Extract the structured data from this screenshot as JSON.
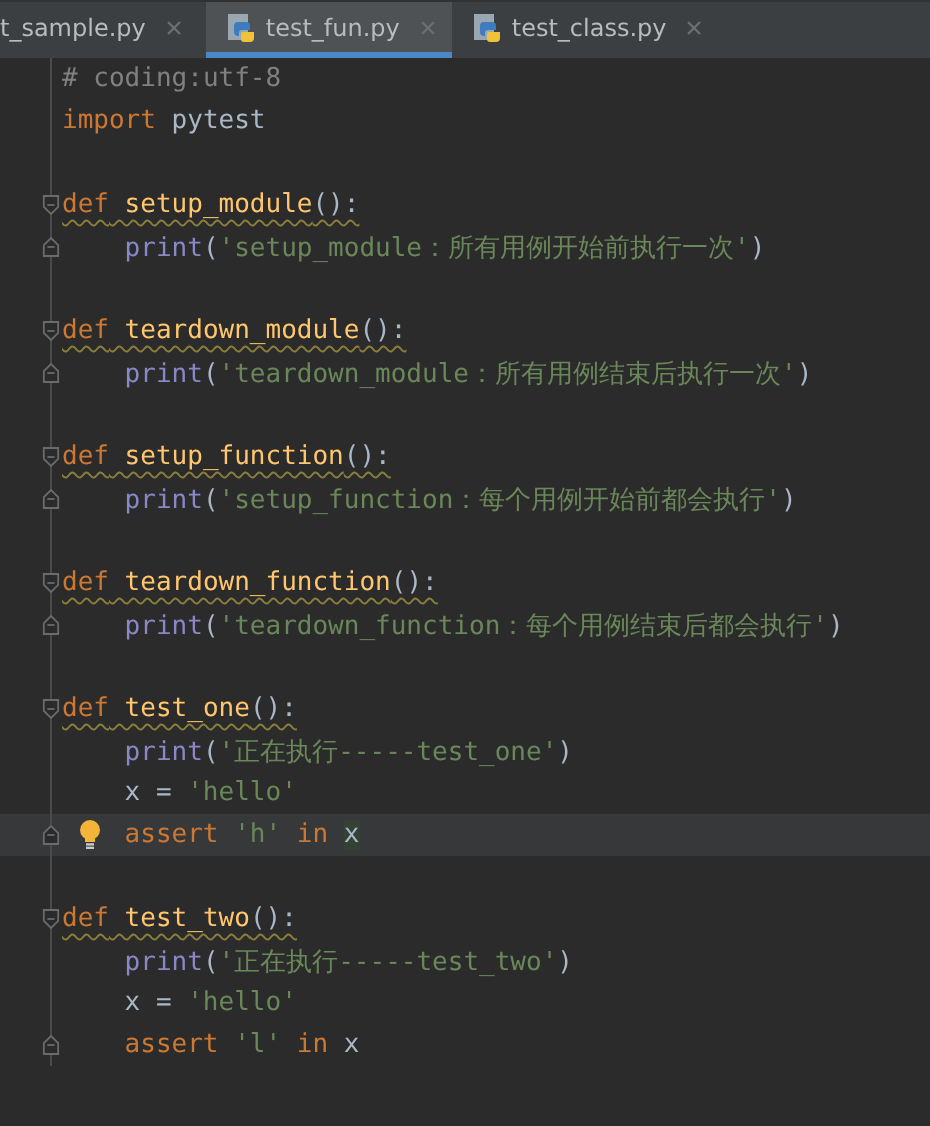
{
  "tabs": [
    {
      "label": "t_sample.py",
      "selected": false,
      "icon": false
    },
    {
      "label": "test_fun.py",
      "selected": true,
      "icon": true
    },
    {
      "label": "test_class.py",
      "selected": false,
      "icon": true
    }
  ],
  "lines": [
    {
      "kind": "code",
      "current": false,
      "warning": false,
      "tokens": [
        {
          "kind": "comment",
          "text": "# coding:utf-8"
        }
      ]
    },
    {
      "kind": "code",
      "current": false,
      "warning": false,
      "tokens": [
        {
          "kind": "keyword",
          "text": "import"
        },
        {
          "kind": "plain",
          "text": " pytest"
        }
      ]
    },
    {
      "kind": "blank",
      "current": false
    },
    {
      "kind": "code",
      "current": false,
      "warning": true,
      "fold_open": true,
      "tokens": [
        {
          "kind": "keyword",
          "text": "def"
        },
        {
          "kind": "func",
          "text": " setup_module"
        },
        {
          "kind": "plain",
          "text": "():"
        }
      ],
      "children": [
        {
          "kind": "code",
          "current": false,
          "warning": false,
          "fold_close": true,
          "tokens": [
            {
              "kind": "builtin",
              "text": "print"
            },
            {
              "kind": "plain",
              "text": "("
            },
            {
              "kind": "string",
              "text": "'setup_module：所有用例开始前执行一次'"
            },
            {
              "kind": "plain",
              "text": ")"
            }
          ]
        }
      ]
    },
    {
      "kind": "blank",
      "current": false
    },
    {
      "kind": "code",
      "current": false,
      "warning": true,
      "fold_open": true,
      "tokens": [
        {
          "kind": "keyword",
          "text": "def"
        },
        {
          "kind": "func",
          "text": " teardown_module"
        },
        {
          "kind": "plain",
          "text": "():"
        }
      ],
      "children": [
        {
          "kind": "code",
          "current": false,
          "warning": false,
          "fold_close": true,
          "tokens": [
            {
              "kind": "builtin",
              "text": "print"
            },
            {
              "kind": "plain",
              "text": "("
            },
            {
              "kind": "string",
              "text": "'teardown_module：所有用例结束后执行一次'"
            },
            {
              "kind": "plain",
              "text": ")"
            }
          ]
        }
      ]
    },
    {
      "kind": "blank",
      "current": false
    },
    {
      "kind": "code",
      "current": false,
      "warning": true,
      "fold_open": true,
      "tokens": [
        {
          "kind": "keyword",
          "text": "def"
        },
        {
          "kind": "func",
          "text": " setup_function"
        },
        {
          "kind": "plain",
          "text": "():"
        }
      ],
      "children": [
        {
          "kind": "code",
          "current": false,
          "warning": false,
          "fold_close": true,
          "tokens": [
            {
              "kind": "builtin",
              "text": "print"
            },
            {
              "kind": "plain",
              "text": "("
            },
            {
              "kind": "string",
              "text": "'setup_function：每个用例开始前都会执行'"
            },
            {
              "kind": "plain",
              "text": ")"
            }
          ]
        }
      ]
    },
    {
      "kind": "blank",
      "current": false
    },
    {
      "kind": "code",
      "current": false,
      "warning": true,
      "fold_open": true,
      "tokens": [
        {
          "kind": "keyword",
          "text": "def"
        },
        {
          "kind": "func",
          "text": " teardown_function"
        },
        {
          "kind": "plain",
          "text": "():"
        }
      ],
      "children": [
        {
          "kind": "code",
          "current": false,
          "warning": false,
          "fold_close": true,
          "tokens": [
            {
              "kind": "builtin",
              "text": "print"
            },
            {
              "kind": "plain",
              "text": "("
            },
            {
              "kind": "string",
              "text": "'teardown_function：每个用例结束后都会执行'"
            },
            {
              "kind": "plain",
              "text": ")"
            }
          ]
        }
      ]
    },
    {
      "kind": "blank",
      "current": false
    },
    {
      "kind": "code",
      "current": false,
      "warning": true,
      "fold_open": true,
      "tokens": [
        {
          "kind": "keyword",
          "text": "def"
        },
        {
          "kind": "func",
          "text": " test_one"
        },
        {
          "kind": "plain",
          "text": "():"
        }
      ],
      "children": [
        {
          "kind": "code",
          "current": false,
          "warning": false,
          "tokens": [
            {
              "kind": "builtin",
              "text": "print"
            },
            {
              "kind": "plain",
              "text": "("
            },
            {
              "kind": "string",
              "text": "'正在执行-----test_one'"
            },
            {
              "kind": "plain",
              "text": ")"
            }
          ]
        },
        {
          "kind": "code",
          "current": false,
          "warning": false,
          "tokens": [
            {
              "kind": "plain",
              "text": "x = "
            },
            {
              "kind": "string",
              "text": "'hello'"
            }
          ]
        },
        {
          "kind": "code",
          "current": true,
          "warning": false,
          "fold_close": true,
          "bulb": true,
          "tokens": [
            {
              "kind": "keyword",
              "text": "assert"
            },
            {
              "kind": "string",
              "text": " 'h'"
            },
            {
              "kind": "keyword",
              "text": " in "
            },
            {
              "kind": "highlight",
              "text": "x"
            }
          ]
        }
      ]
    },
    {
      "kind": "blank",
      "current": false
    },
    {
      "kind": "code",
      "current": false,
      "warning": true,
      "fold_open": true,
      "tokens": [
        {
          "kind": "keyword",
          "text": "def"
        },
        {
          "kind": "func",
          "text": " test_two"
        },
        {
          "kind": "plain",
          "text": "():"
        }
      ],
      "children": [
        {
          "kind": "code",
          "current": false,
          "warning": false,
          "tokens": [
            {
              "kind": "builtin",
              "text": "print"
            },
            {
              "kind": "plain",
              "text": "("
            },
            {
              "kind": "string",
              "text": "'正在执行-----test_two'"
            },
            {
              "kind": "plain",
              "text": ")"
            }
          ]
        },
        {
          "kind": "code",
          "current": false,
          "warning": false,
          "tokens": [
            {
              "kind": "plain",
              "text": "x = "
            },
            {
              "kind": "string",
              "text": "'hello'"
            }
          ]
        },
        {
          "kind": "code",
          "current": false,
          "warning": false,
          "fold_close": true,
          "tokens": [
            {
              "kind": "keyword",
              "text": "assert"
            },
            {
              "kind": "string",
              "text": " 'l'"
            },
            {
              "kind": "keyword",
              "text": " in"
            },
            {
              "kind": "plain",
              "text": " x"
            }
          ]
        }
      ]
    }
  ]
}
